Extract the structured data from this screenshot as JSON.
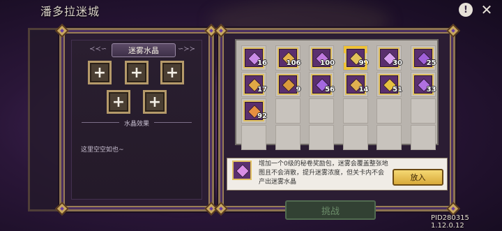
{
  "header": {
    "title": "潘多拉迷城",
    "info_icon_glyph": "!",
    "close_icon_glyph": "✕"
  },
  "left_panel": {
    "banner_title": "迷雾水晶",
    "banner_wing_left": "≺≺∽",
    "banner_wing_right": "∽≻≻",
    "slot_glyph": "+",
    "effects_label": "水晶效果",
    "empty_text": "这里空空如也~",
    "ghost_text": "这"
  },
  "inventory": {
    "items": [
      {
        "count": "16",
        "gem_color": "#c98be6"
      },
      {
        "count": "106",
        "gem_color": "#e3b24a"
      },
      {
        "count": "100",
        "gem_color": "#c079e0"
      },
      {
        "count": "99",
        "gem_color": "#e2c25a",
        "selected": true
      },
      {
        "count": "30",
        "gem_color": "#d6a0f0"
      },
      {
        "count": "25",
        "gem_color": "#a060d8"
      },
      {
        "count": "17",
        "gem_color": "#e0a845"
      },
      {
        "count": "9",
        "gem_color": "#d99a3c"
      },
      {
        "count": "56",
        "gem_color": "#a468e0"
      },
      {
        "count": "14",
        "gem_color": "#e0b050"
      },
      {
        "count": "51",
        "gem_color": "#e6c040"
      },
      {
        "count": "33",
        "gem_color": "#b070e0"
      },
      {
        "count": "92",
        "gem_color": "#e89040"
      }
    ]
  },
  "description": {
    "text": "增加一个0级的秘卷奖励包，迷雾会覆盖整张地图且不会消散，提升迷雾浓度，但关卡内不会产出迷雾水晶",
    "put_button": "放入"
  },
  "footer": {
    "challenge_button": "挑战",
    "version": "PID280315 1.12.0.12"
  },
  "colors": {
    "accent_gold": "#e1c060",
    "panel_border": "#8c7350",
    "bg_purple": "#2a1638"
  }
}
